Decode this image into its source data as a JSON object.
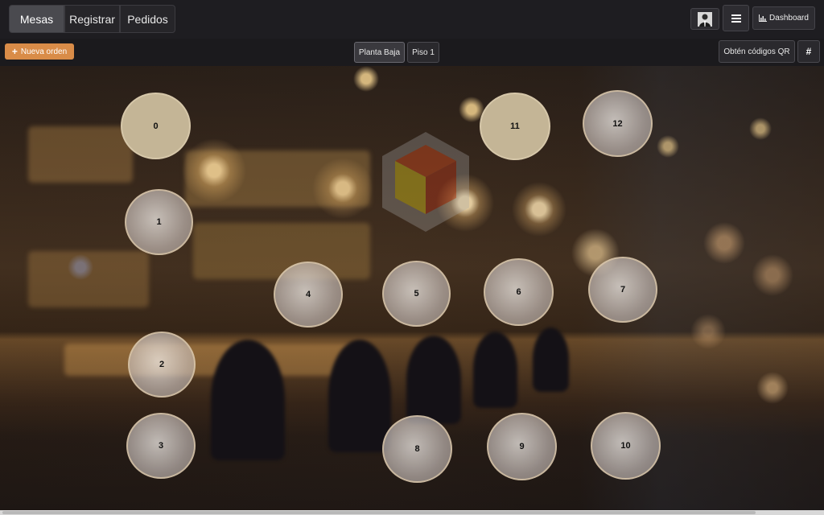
{
  "nav": {
    "tabs": [
      {
        "label": "Mesas",
        "active": true
      },
      {
        "label": "Registrar",
        "active": false
      },
      {
        "label": "Pedidos",
        "active": false
      }
    ],
    "menu_icon": "hamburger-icon",
    "dashboard_label": "Dashboard",
    "dashboard_icon": "bar-chart-icon"
  },
  "toolbar": {
    "new_order_label": "Nueva orden",
    "new_order_icon": "plus-icon",
    "floors": [
      {
        "label": "Planta Baja",
        "active": true
      },
      {
        "label": "Piso 1",
        "active": false
      }
    ],
    "qr_label": "Obtén códigos QR",
    "hash_label": "#"
  },
  "tables": [
    {
      "label": "0",
      "state": "busy"
    },
    {
      "label": "1",
      "state": "free"
    },
    {
      "label": "2",
      "state": "free"
    },
    {
      "label": "3",
      "state": "free"
    },
    {
      "label": "4",
      "state": "free"
    },
    {
      "label": "5",
      "state": "free"
    },
    {
      "label": "6",
      "state": "free"
    },
    {
      "label": "7",
      "state": "free"
    },
    {
      "label": "8",
      "state": "free"
    },
    {
      "label": "9",
      "state": "free"
    },
    {
      "label": "10",
      "state": "free"
    },
    {
      "label": "11",
      "state": "busy"
    },
    {
      "label": "12",
      "state": "free"
    }
  ],
  "colors": {
    "accent": "#d98c48",
    "busy_table": "#c4b596",
    "topbar": "#1e1d21"
  }
}
